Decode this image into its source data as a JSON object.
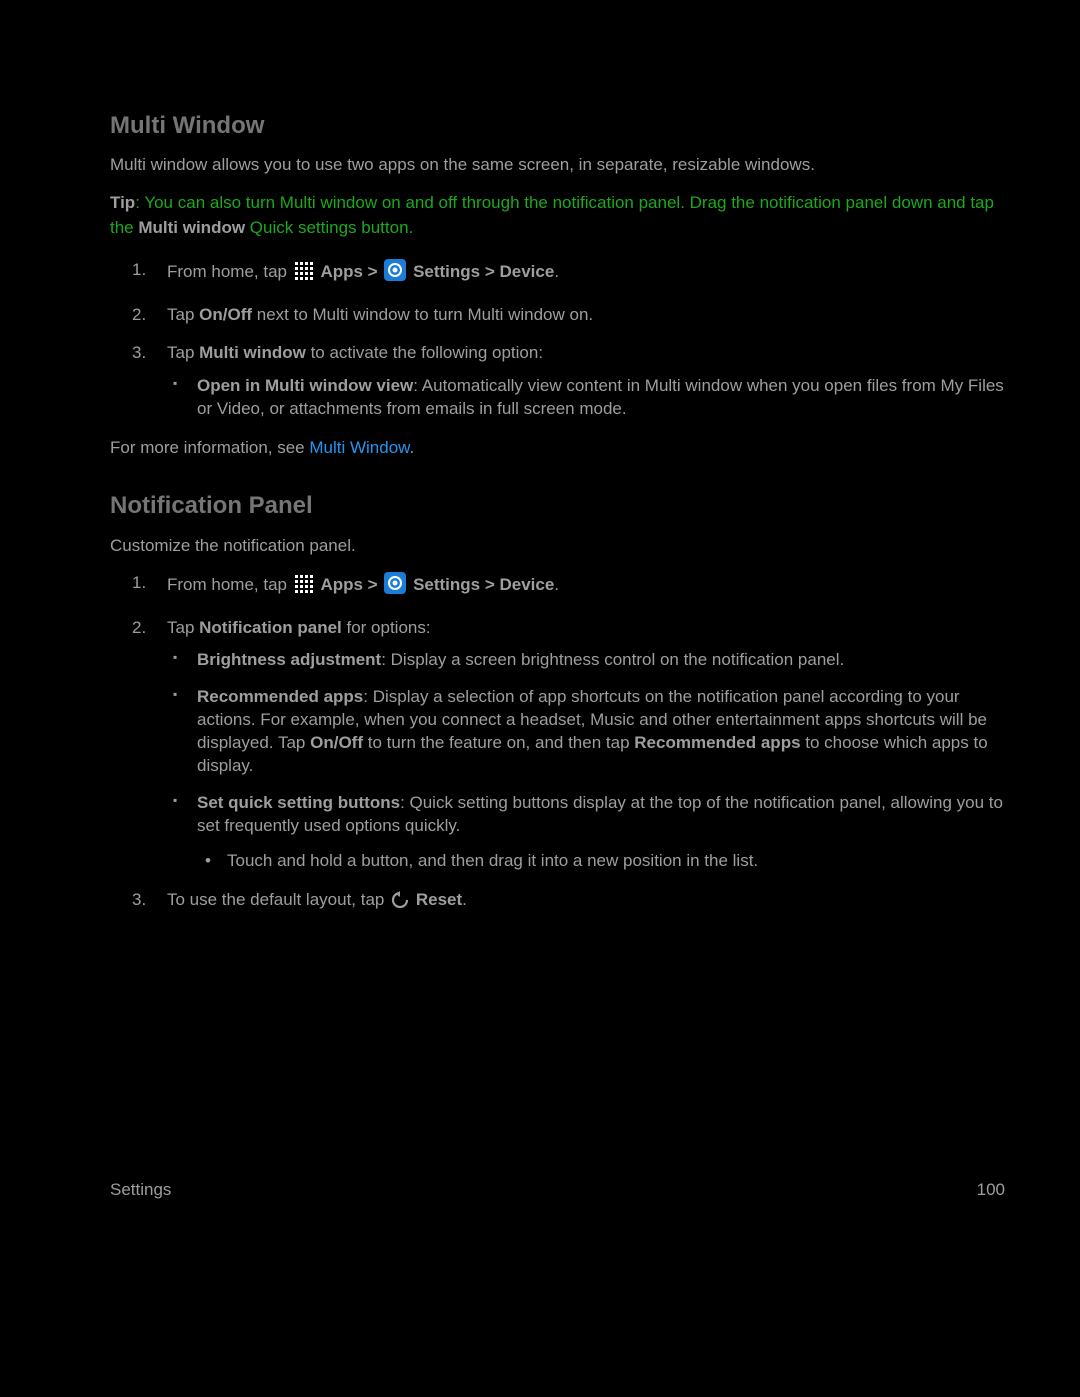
{
  "section1": {
    "heading": "Multi Window",
    "intro": "Multi window allows you to use two apps on the same screen, in separate, resizable windows.",
    "tip_label": "Tip",
    "tip_a": ": You can also turn Multi window on and off through the notification panel. Drag the notification panel down and tap the ",
    "tip_bold": "Multi window",
    "tip_b": " Quick settings button.",
    "steps": {
      "s1": {
        "num": "1.",
        "a": "From home, tap ",
        "apps": "Apps > ",
        "settings": "Settings > Device",
        "end": "."
      },
      "s2": {
        "num": "2.",
        "a": "Tap ",
        "onoff": "On/Off",
        "b": " next to Multi window to turn Multi window on."
      },
      "s3": {
        "num": "3.",
        "a": "Tap ",
        "mw": "Multi window",
        "b": " to activate the following option:",
        "b1": {
          "t": "Open in Multi window view",
          "rest": ": Automatically view content in Multi window when you open files from My Files or Video, or attachments from emails in full screen mode."
        }
      }
    },
    "more_a": "For more information, see ",
    "more_link": "Multi Window",
    "more_b": "."
  },
  "section2": {
    "heading": "Notification Panel",
    "intro": "Customize the notification panel.",
    "steps": {
      "s1": {
        "num": "1.",
        "a": "From home, tap ",
        "apps": "Apps > ",
        "settings": "Settings > Device",
        "end": "."
      },
      "s2": {
        "num": "2.",
        "a": "Tap ",
        "np": "Notification panel",
        "b": " for options:",
        "b1": {
          "t": "Brightness adjustment",
          "rest": ": Display a screen brightness control on the notification panel."
        },
        "b2": {
          "t": "Recommended apps",
          "a": ": Display a selection of app shortcuts on the notification panel according to your actions. For example, when you connect a headset, Music and other entertainment apps shortcuts will be displayed. Tap ",
          "onoff": "On/Off",
          "b": " to turn the feature on, and then tap ",
          "ra": "Recommended apps",
          "c": " to choose which apps to display."
        },
        "b3": {
          "t": "Set quick setting buttons",
          "rest": ": Quick setting buttons display at the top of the notification panel, allowing you to set frequently used options quickly.",
          "sub": "Touch and hold a button, and then drag it into a new position in the list."
        }
      },
      "s3": {
        "num": "3.",
        "a": "To use the default layout, tap ",
        "reset": "Reset",
        "end": "."
      }
    }
  },
  "footer": {
    "left": "Settings",
    "right": "100"
  }
}
